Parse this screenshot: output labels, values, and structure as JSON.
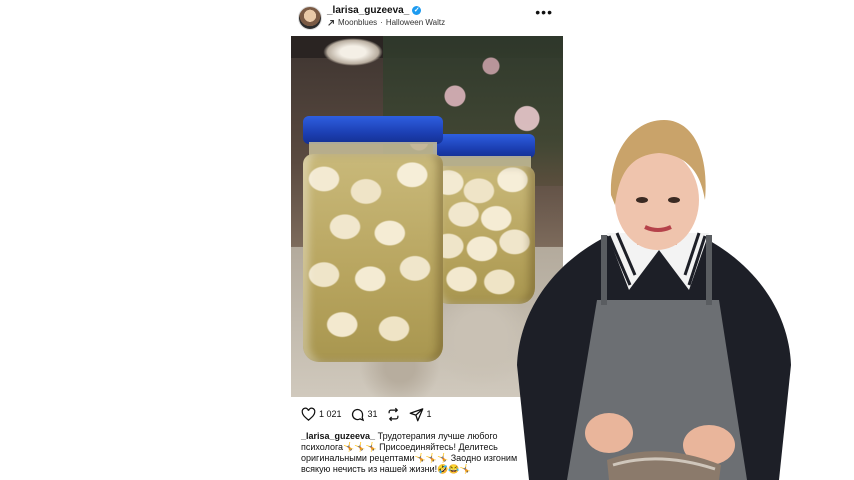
{
  "post": {
    "username": "_larisa_guzeeva_",
    "verified_mark": "✓",
    "music_icon": "arrow-up-right-icon",
    "music_artist": "Moonblues",
    "music_separator": "·",
    "music_title": "Halloween Waltz",
    "more_icon": "more-dots-icon",
    "photo_subject": "Two glass jars of pickled garlic with blue lids"
  },
  "actions": {
    "likes": "1 021",
    "comments": "31",
    "shares": "1"
  },
  "caption": {
    "username": "_larisa_guzeeva_",
    "text": "Трудотерапия лучше любого психолога🤸🤸🤸 Присоединяйтесь! Делитесь оригинальными рецептами🤸🤸🤸 Заодно изгоним всякую нечисть из нашей жизни!🤣😂🤸"
  },
  "colors": {
    "lid_blue": "#1c3fb3",
    "verified_blue": "#1d9bf0",
    "apron_gray": "#6c6f73"
  }
}
